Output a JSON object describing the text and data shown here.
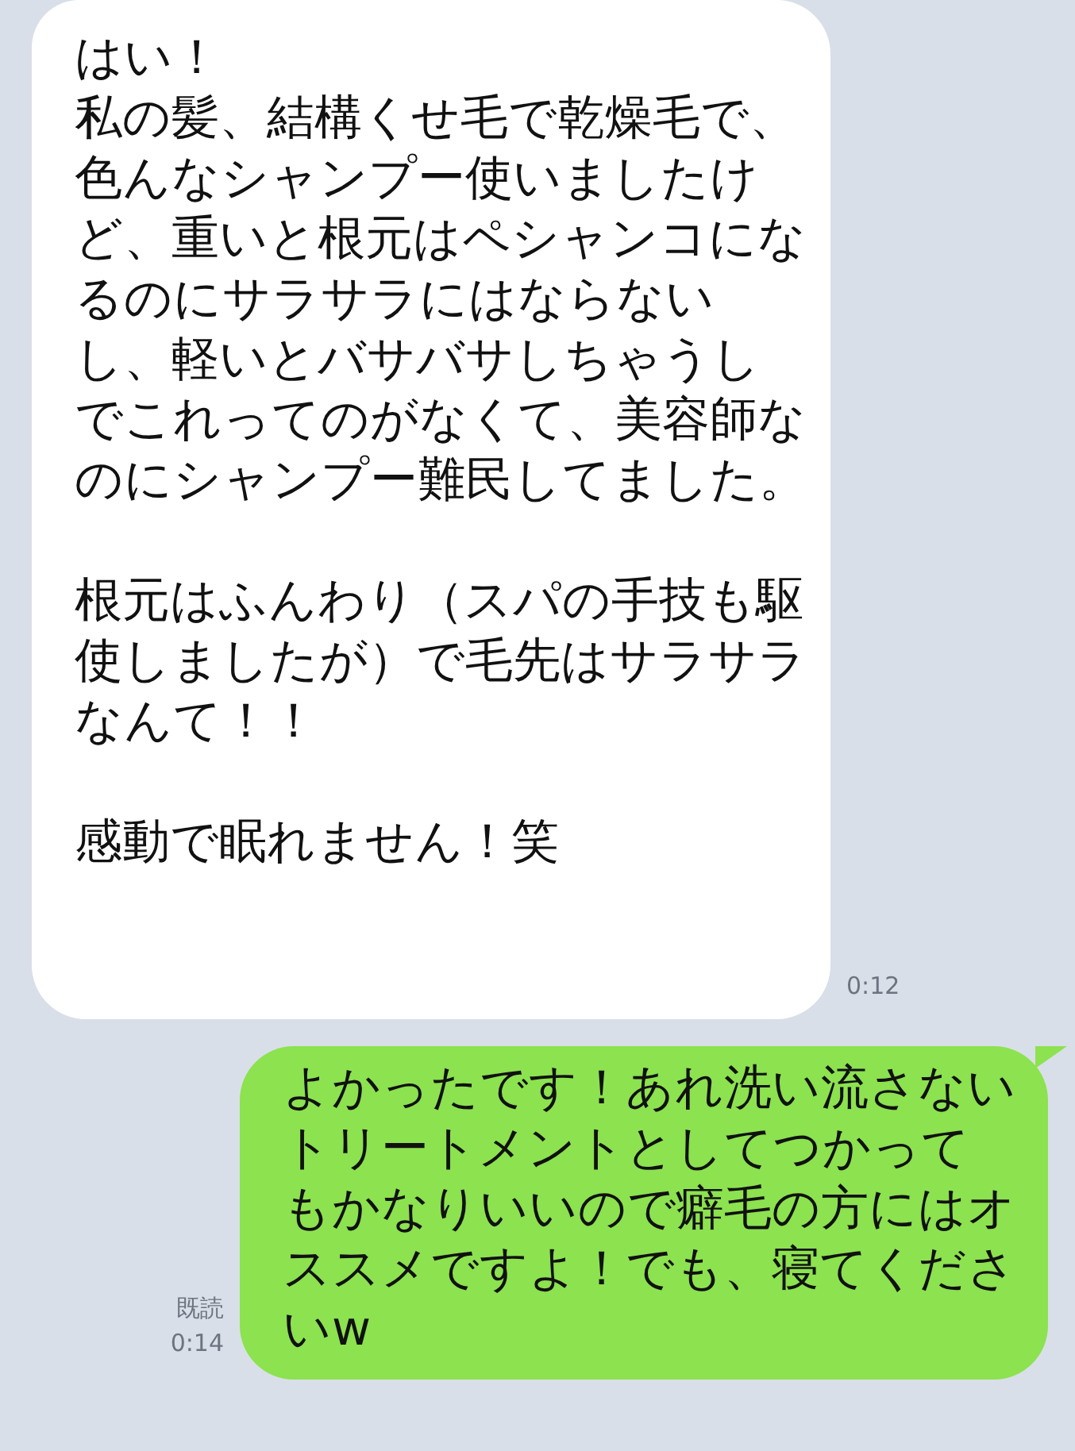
{
  "messages": [
    {
      "kind": "received",
      "blocks": [
        [
          "はい！",
          "私の髪、結構くせ毛で乾燥毛で、色んなシャンプー使いましたけど、重いと根元はペシャンコになるのにサラサラにはならないし、軽いとバサバサしちゃうしでこれってのがなくて、美容師なのにシャンプー難民してました。"
        ],
        [
          "根元はふんわり（スパの手技も駆使しましたが）で毛先はサラサラなんて！！"
        ],
        [
          "感動で眠れません！笑"
        ]
      ],
      "time": "0:12"
    },
    {
      "kind": "sent",
      "blocks": [
        [
          "よかったです！あれ洗い流さないトリートメントとしてつかってもかなりいいので癖毛の方にはオススメですよ！でも、寝てくださいw"
        ]
      ],
      "read": "既読",
      "time": "0:14"
    }
  ]
}
